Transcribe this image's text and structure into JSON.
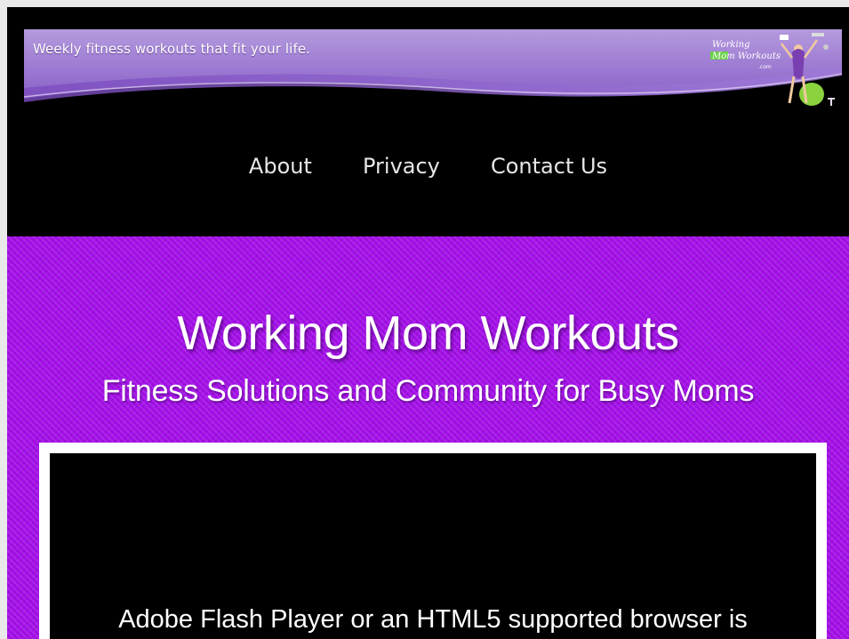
{
  "header": {
    "tagline": "Weekly fitness workouts that fit your life.",
    "logo_text": "Working Mom Workouts"
  },
  "nav": {
    "items": [
      {
        "label": "About"
      },
      {
        "label": "Privacy"
      },
      {
        "label": "Contact Us"
      }
    ]
  },
  "hero": {
    "title": "Working Mom Workouts",
    "subtitle": "Fitness Solutions and Community for Busy Moms"
  },
  "video": {
    "message": "Adobe Flash Player or an HTML5 supported browser is"
  },
  "colors": {
    "page_background": "#000000",
    "hero_purple": "#a50fea",
    "banner_purple": "#9b7ad0"
  }
}
